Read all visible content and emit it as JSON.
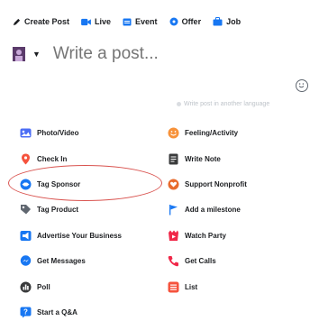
{
  "toolbar": {
    "create_post": "Create Post",
    "live": "Live",
    "event": "Event",
    "offer": "Offer",
    "job": "Job"
  },
  "composer": {
    "placeholder": "Write a post..."
  },
  "language_hint": "Write post in another language",
  "options_left": [
    {
      "label": "Photo/Video",
      "icon": "photo-icon",
      "color": "#45bd62"
    },
    {
      "label": "Check In",
      "icon": "location-pin-icon",
      "color": "#f5533d"
    },
    {
      "label": "Tag Sponsor",
      "icon": "handshake-icon",
      "color": "#1877f2"
    },
    {
      "label": "Tag Product",
      "icon": "tag-icon",
      "color": "#606770"
    },
    {
      "label": "Advertise Your Business",
      "icon": "megaphone-icon",
      "color": "#1877f2"
    },
    {
      "label": "Get Messages",
      "icon": "messenger-icon",
      "color": "#1877f2"
    },
    {
      "label": "Poll",
      "icon": "poll-icon",
      "color": "#606770"
    },
    {
      "label": "Start a Q&A",
      "icon": "question-icon",
      "color": "#1877f2"
    }
  ],
  "options_right": [
    {
      "label": "Feeling/Activity",
      "icon": "smiley-icon",
      "color": "#f7b928"
    },
    {
      "label": "Write Note",
      "icon": "note-icon",
      "color": "#606770"
    },
    {
      "label": "Support Nonprofit",
      "icon": "heart-hands-icon",
      "color": "#e86c2e"
    },
    {
      "label": "Add a milestone",
      "icon": "flag-icon",
      "color": "#1877f2"
    },
    {
      "label": "Watch Party",
      "icon": "watch-party-icon",
      "color": "#f02849"
    },
    {
      "label": "Get Calls",
      "icon": "phone-icon",
      "color": "#f02849"
    },
    {
      "label": "List",
      "icon": "list-icon",
      "color": "#f5533d"
    }
  ],
  "highlight_color": "#d9534f"
}
